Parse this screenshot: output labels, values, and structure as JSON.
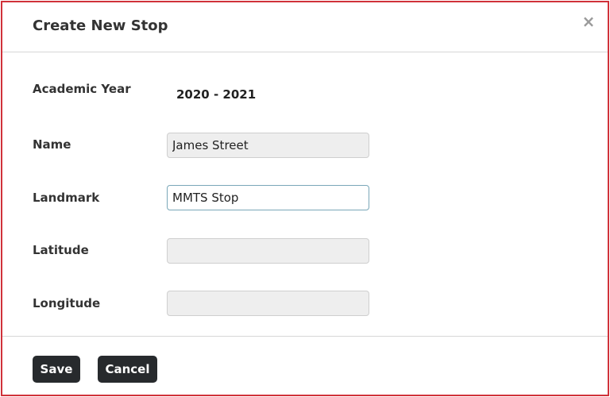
{
  "dialog": {
    "title": "Create New Stop",
    "close_glyph": "×"
  },
  "form": {
    "academic_year": {
      "label": "Academic Year",
      "value": "2020 - 2021"
    },
    "name": {
      "label": "Name",
      "value": "James Street"
    },
    "landmark": {
      "label": "Landmark",
      "value": "MMTS Stop"
    },
    "latitude": {
      "label": "Latitude",
      "value": ""
    },
    "longitude": {
      "label": "Longitude",
      "value": ""
    }
  },
  "footer": {
    "save_label": "Save",
    "cancel_label": "Cancel"
  },
  "colors": {
    "border_accent": "#d0313a",
    "button_bg": "#272a2d",
    "focus_border": "#7aa7b8",
    "input_bg": "#eeeeee"
  }
}
